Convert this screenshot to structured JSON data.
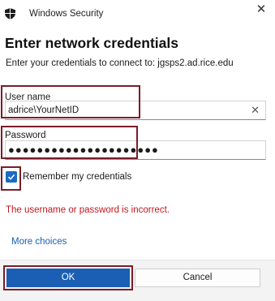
{
  "window": {
    "title": "Windows Security",
    "shield_icon": "shield-icon",
    "close_glyph": "✕"
  },
  "dialog": {
    "heading": "Enter network credentials",
    "subtext": "Enter your credentials to connect to: jgsps2.ad.rice.edu"
  },
  "username": {
    "label": "User name",
    "value": "adrice\\YourNetID",
    "clear_glyph": "✕"
  },
  "password": {
    "label": "Password",
    "value": "●●●●●●●●●●●●●●●●●●●●●"
  },
  "remember": {
    "label": "Remember my credentials",
    "checked": true
  },
  "error_message": "The username or password is incorrect.",
  "more_choices": "More choices",
  "buttons": {
    "ok": "OK",
    "cancel": "Cancel"
  },
  "colors": {
    "accent": "#1a5fb4",
    "error": "#c4161c",
    "highlight_border": "#7b1c2a"
  }
}
